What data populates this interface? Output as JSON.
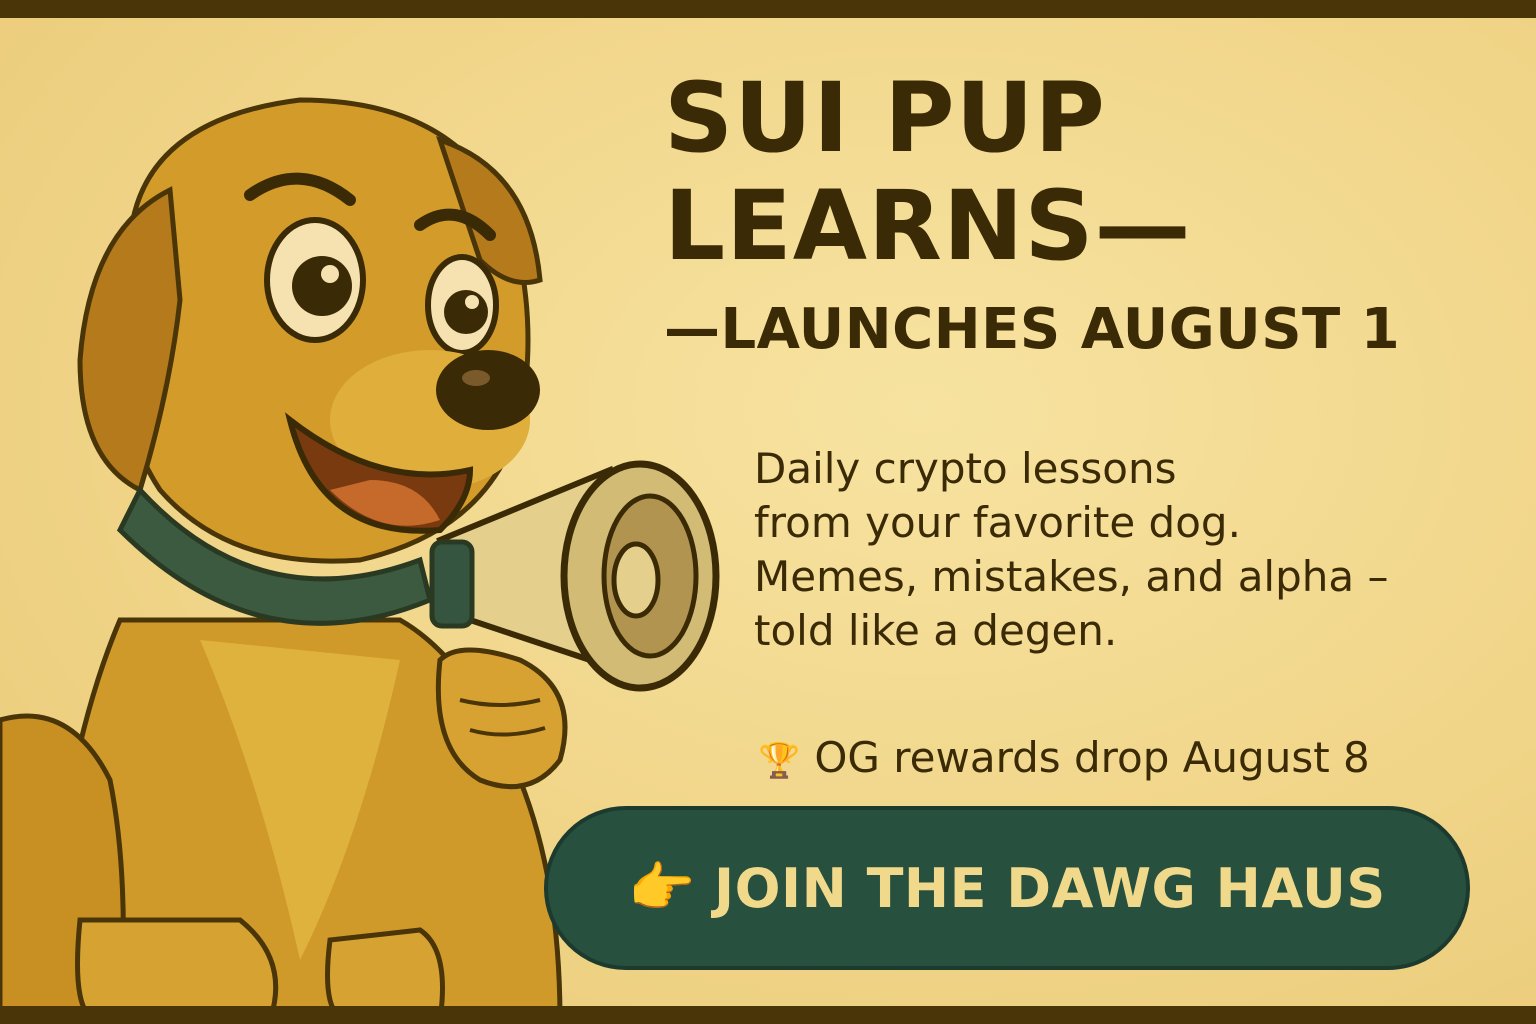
{
  "headline": {
    "line1": "SUI PUP",
    "line2": "LEARNS—",
    "line3": "—LAUNCHES AUGUST 1"
  },
  "description": {
    "line1": "Daily crypto lessons",
    "line2": "from your favorite dog.",
    "line3": "Memes, mistakes, and alpha –",
    "line4": "told like a degen."
  },
  "rewards": {
    "icon": "trophy-icon",
    "text": "OG rewards drop August 8"
  },
  "cta": {
    "icon": "pointing-hand-icon",
    "label": "JOIN THE DAWG HAUS"
  },
  "illustration": {
    "subject": "golden-retriever-puppy-with-megaphone"
  },
  "colors": {
    "background": "#f2d98c",
    "text": "#3b2a06",
    "button": "#27503f",
    "button_text": "#f0d98a",
    "border": "#4a3508"
  }
}
